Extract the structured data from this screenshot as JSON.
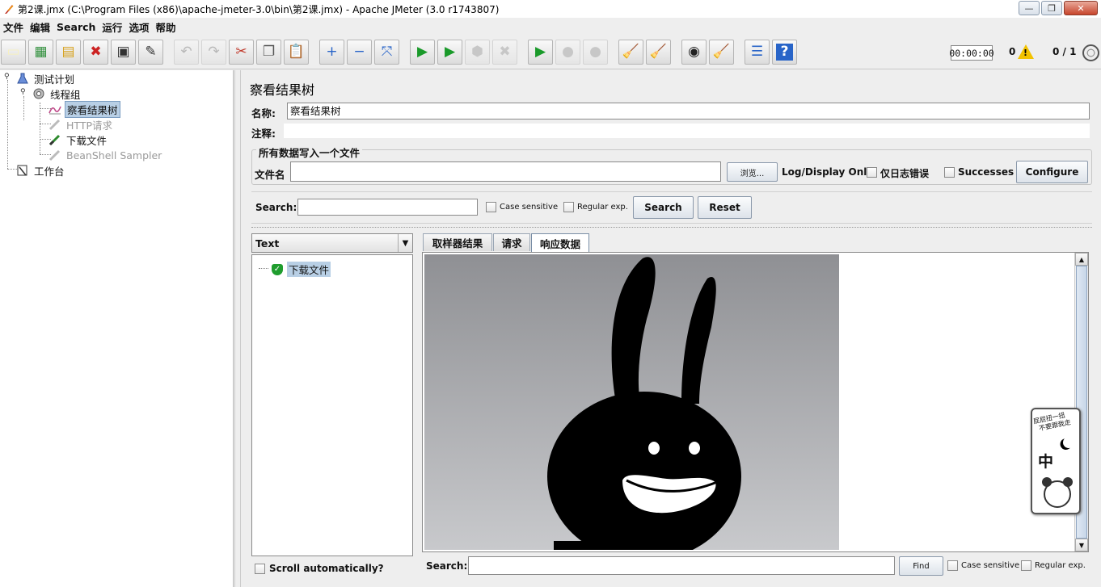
{
  "window": {
    "title": "第2课.jmx (C:\\Program Files (x86)\\apache-jmeter-3.0\\bin\\第2课.jmx) - Apache JMeter (3.0 r1743807)"
  },
  "menubar": [
    "文件",
    "编辑",
    "Search",
    "运行",
    "选项",
    "帮助"
  ],
  "toolbar": {
    "buttons": [
      {
        "name": "new-icon",
        "glyph": "▭",
        "color": "#f6f0c0",
        "disabled": false
      },
      {
        "name": "templates-icon",
        "glyph": "▦",
        "color": "#2f8f3b",
        "disabled": false
      },
      {
        "name": "open-icon",
        "glyph": "▤",
        "color": "#d6a019",
        "disabled": false
      },
      {
        "name": "close-icon",
        "glyph": "✖",
        "color": "#cc2222",
        "disabled": false
      },
      {
        "name": "save-icon",
        "glyph": "▣",
        "color": "#333333",
        "disabled": false
      },
      {
        "name": "save-as-icon",
        "glyph": "✎",
        "color": "#333333",
        "disabled": false
      },
      {
        "name": "undo-icon",
        "glyph": "↶",
        "color": "#777777",
        "disabled": true
      },
      {
        "name": "redo-icon",
        "glyph": "↷",
        "color": "#777777",
        "disabled": true
      },
      {
        "name": "cut-icon",
        "glyph": "✂",
        "color": "#c0392b",
        "disabled": false
      },
      {
        "name": "copy-icon",
        "glyph": "❐",
        "color": "#555555",
        "disabled": false
      },
      {
        "name": "paste-icon",
        "glyph": "📋",
        "color": "#8a5a20",
        "disabled": false
      },
      {
        "name": "expand-icon",
        "glyph": "+",
        "color": "#2864c8",
        "disabled": false
      },
      {
        "name": "collapse-icon",
        "glyph": "−",
        "color": "#2864c8",
        "disabled": false
      },
      {
        "name": "toggle-icon",
        "glyph": "⤧",
        "color": "#2864c8",
        "disabled": false
      },
      {
        "name": "start-icon",
        "glyph": "▶",
        "color": "#1a9a2a",
        "disabled": false
      },
      {
        "name": "start-no-pause-icon",
        "glyph": "▶",
        "color": "#1a9a2a",
        "disabled": false
      },
      {
        "name": "stop-icon",
        "glyph": "⬢",
        "color": "#999999",
        "disabled": true
      },
      {
        "name": "shutdown-icon",
        "glyph": "✖",
        "color": "#999999",
        "disabled": true
      },
      {
        "name": "remote-start-icon",
        "glyph": "▶",
        "color": "#1a9a2a",
        "disabled": false
      },
      {
        "name": "remote-stop-icon",
        "glyph": "●",
        "color": "#999999",
        "disabled": true
      },
      {
        "name": "remote-shutdown-icon",
        "glyph": "●",
        "color": "#999999",
        "disabled": true
      },
      {
        "name": "clear-icon",
        "glyph": "🧹",
        "color": "#8a6a3a",
        "disabled": false
      },
      {
        "name": "clear-all-icon",
        "glyph": "🧹",
        "color": "#8a6a3a",
        "disabled": false
      },
      {
        "name": "search-binoculars-icon",
        "glyph": "◉",
        "color": "#222222",
        "disabled": false
      },
      {
        "name": "reset-search-icon",
        "glyph": "🧹",
        "color": "#d6a019",
        "disabled": false
      },
      {
        "name": "function-helper-icon",
        "glyph": "☰",
        "color": "#2864c8",
        "disabled": false
      },
      {
        "name": "help-icon",
        "glyph": "?",
        "color": "#ffffff",
        "disabled": false
      }
    ],
    "timer": "00:00:00",
    "error_count": "0",
    "threads": "0 / 1"
  },
  "tree": {
    "items": [
      {
        "label": "测试计划",
        "icon": "test-plan-icon"
      },
      {
        "label": "线程组",
        "icon": "thread-group-icon"
      },
      {
        "label": "察看结果树",
        "icon": "listener-icon"
      },
      {
        "label": "HTTP请求",
        "icon": "sampler-icon"
      },
      {
        "label": "下载文件",
        "icon": "sampler-icon"
      },
      {
        "label": "BeanShell Sampler",
        "icon": "sampler-icon"
      },
      {
        "label": "工作台",
        "icon": "workbench-icon"
      }
    ]
  },
  "panel": {
    "title": "察看结果树",
    "name_label": "名称:",
    "name_value": "察看结果树",
    "comment_label": "注释:",
    "group_legend": "所有数据写入一个文件",
    "filename_label": "文件名",
    "browse_label": "浏览...",
    "log_display_label": "Log/Display Only:",
    "errors_only_label": "仅日志错误",
    "successes_label": "Successes",
    "configure_label": "Configure",
    "search_label": "Search:",
    "case_sensitive_label": "Case sensitive",
    "regex_label": "Regular exp.",
    "search_button": "Search",
    "reset_button": "Reset"
  },
  "results": {
    "renderer": "Text",
    "items": [
      "下载文件"
    ],
    "scroll_auto_label": "Scroll automatically?",
    "tabs": [
      "取样器结果",
      "请求",
      "响应数据"
    ],
    "active_tab": 2,
    "find_label": "Search:",
    "find_button": "Find",
    "find_case_label": "Case sensitive",
    "find_regex_label": "Regular exp."
  },
  "widget": {
    "line1": "屁屁扭一扭",
    "line2": "不要跟我走",
    "char": "中"
  }
}
